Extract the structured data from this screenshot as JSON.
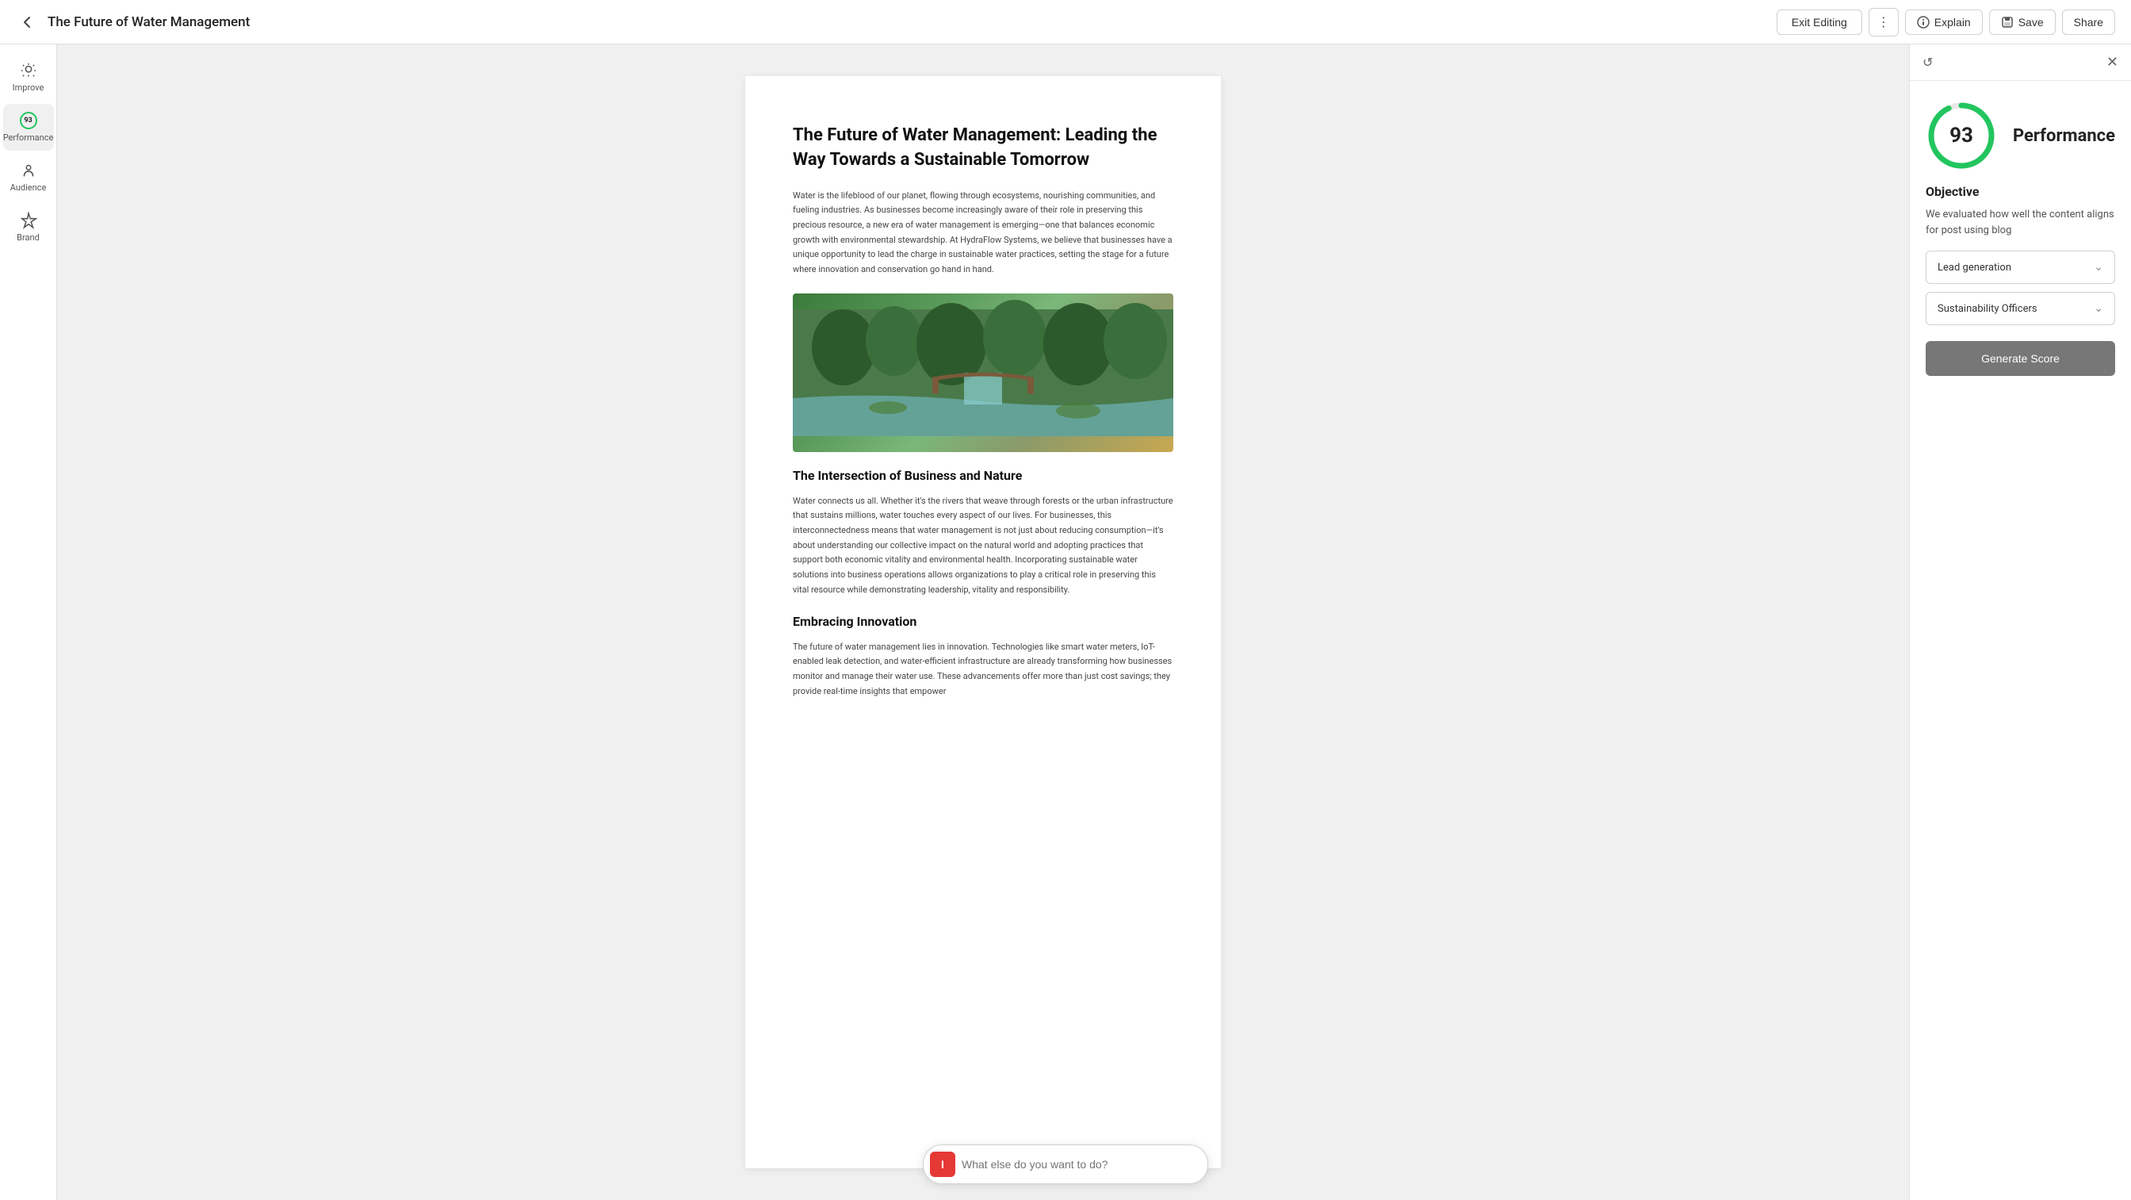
{
  "topbar": {
    "back_icon": "←",
    "title": "The Future of Water Management",
    "exit_label": "Exit Editing",
    "more_icon": "⋮",
    "explain_icon": "💡",
    "explain_label": "Explain",
    "save_icon": "💾",
    "save_label": "Save",
    "share_label": "Share"
  },
  "sidebar": {
    "items": [
      {
        "id": "improve",
        "icon": "improve",
        "label": "Improve",
        "active": false
      },
      {
        "id": "performance",
        "icon": "performance",
        "label": "Performance",
        "active": true
      },
      {
        "id": "audience",
        "icon": "audience",
        "label": "Audience",
        "active": false
      },
      {
        "id": "brand",
        "icon": "brand",
        "label": "Brand",
        "active": false
      }
    ]
  },
  "document": {
    "title": "The Future of Water Management: Leading the Way Towards a Sustainable Tomorrow",
    "intro": "Water is the lifeblood of our planet, flowing through ecosystems, nourishing communities, and fueling industries. As businesses become increasingly aware of their role in preserving this precious resource, a new era of water management is emerging—one that balances economic growth with environmental stewardship. At HydraFlow Systems, we believe that businesses have a unique opportunity to lead the charge in sustainable water practices, setting the stage for a future where innovation and conservation go hand in hand.",
    "section1_title": "The Intersection of Business and Nature",
    "section1_text": "Water connects us all. Whether it's the rivers that weave through forests or the urban infrastructure that sustains millions, water touches every aspect of our lives. For businesses, this interconnectedness means that water management is not just about reducing consumption—it's about understanding our collective impact on the natural world and adopting practices that support both economic vitality and environmental health. Incorporating sustainable water solutions into business operations allows organizations to play a critical role in preserving this vital resource while demonstrating leadership, vitality and responsibility.",
    "section2_title": "Embracing Innovation",
    "section2_text": "The future of water management lies in innovation. Technologies like smart water meters, IoT-enabled leak detection, and water-efficient infrastructure are already transforming how businesses monitor and manage their water use. These advancements offer more than just cost savings; they provide real-time insights that empower"
  },
  "right_panel": {
    "score": 93,
    "score_label": "Performance",
    "objective_title": "Objective",
    "objective_desc": "We evaluated how well the content aligns for post using blog",
    "lead_generation_label": "Lead generation",
    "sustainability_officers_label": "Sustainability Officers",
    "generate_btn_label": "Generate Score",
    "refresh_icon": "↺",
    "close_icon": "✕"
  },
  "chat": {
    "placeholder": "What else do you want to do?",
    "icon_label": "I"
  },
  "colors": {
    "score_green": "#22c55e",
    "score_circle_bg": "#e8e8e8",
    "generate_btn_bg": "#777777"
  }
}
